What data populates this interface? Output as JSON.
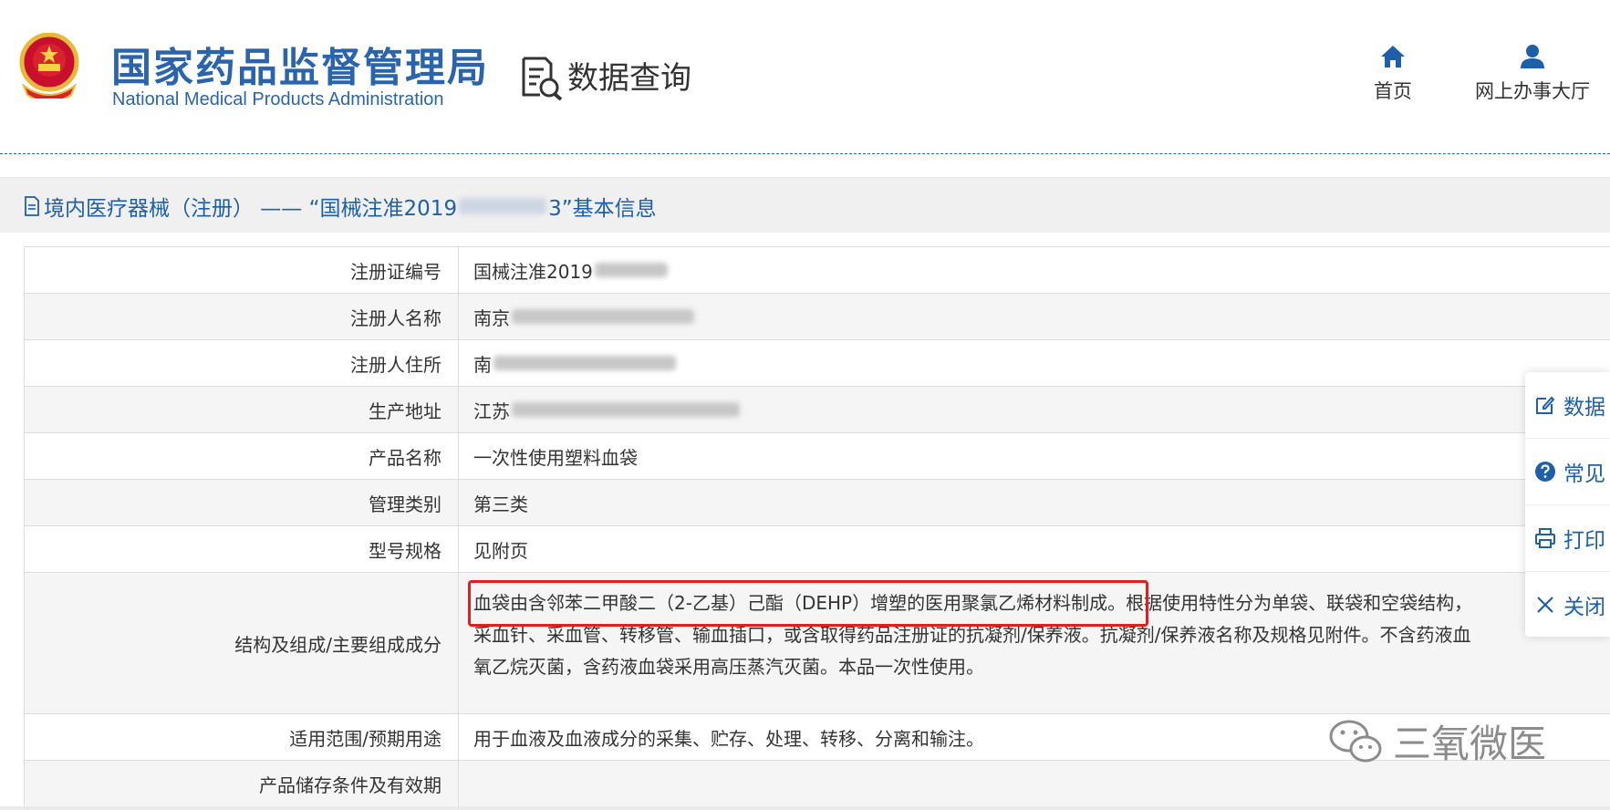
{
  "header": {
    "brand_cn": "国家药品监督管理局",
    "brand_en": "National Medical Products Administration",
    "query_label": "数据查询",
    "nav": {
      "home": "首页",
      "online_hall": "网上办事大厅"
    },
    "brand_color": "#2a64ad"
  },
  "section": {
    "title_prefix": "境内医疗器械（注册） —— “国械注准2019",
    "title_suffix": "3”基本信息"
  },
  "table": {
    "rows": [
      {
        "label": "注册证编号",
        "value": "国械注准2019"
      },
      {
        "label": "注册人名称",
        "value": "南京"
      },
      {
        "label": "注册人住所",
        "value": "南"
      },
      {
        "label": "生产地址",
        "value": "江苏"
      },
      {
        "label": "产品名称",
        "value": "一次性使用塑料血袋"
      },
      {
        "label": "管理类别",
        "value": "第三类"
      },
      {
        "label": "型号规格",
        "value": "见附页"
      },
      {
        "label": "结构及组成/主要组成成分",
        "line1_highlight": "血袋由含邻苯二甲酸二（2-乙基）己酯（DEHP）增塑的医用聚氯乙烯材料制成。",
        "line1_rest": "根据使用特性分为单袋、联袋和空袋结构，",
        "line2": "采血针、采血管、转移管、输血插口，或含取得药品注册证的抗凝剂/保养液。抗凝剂/保养液名称及规格见附件。不含药液血",
        "line3": "氧乙烷灭菌，含药液血袋采用高压蒸汽灭菌。本品一次性使用。"
      },
      {
        "label": "适用范围/预期用途",
        "value": "用于血液及血液成分的采集、贮存、处理、转移、分离和输注。"
      },
      {
        "label": "产品储存条件及有效期",
        "value": ""
      }
    ]
  },
  "float_toolbar": {
    "items": [
      {
        "label": "数据",
        "icon": "edit-icon"
      },
      {
        "label": "常见",
        "icon": "question-icon"
      },
      {
        "label": "打印",
        "icon": "print-icon"
      },
      {
        "label": "关闭",
        "icon": "close-icon"
      }
    ]
  },
  "watermark": {
    "text": "三氧微医",
    "icon": "wechat-icon"
  },
  "colors": {
    "accent": "#1d5fa8",
    "highlight": "#e02020"
  }
}
